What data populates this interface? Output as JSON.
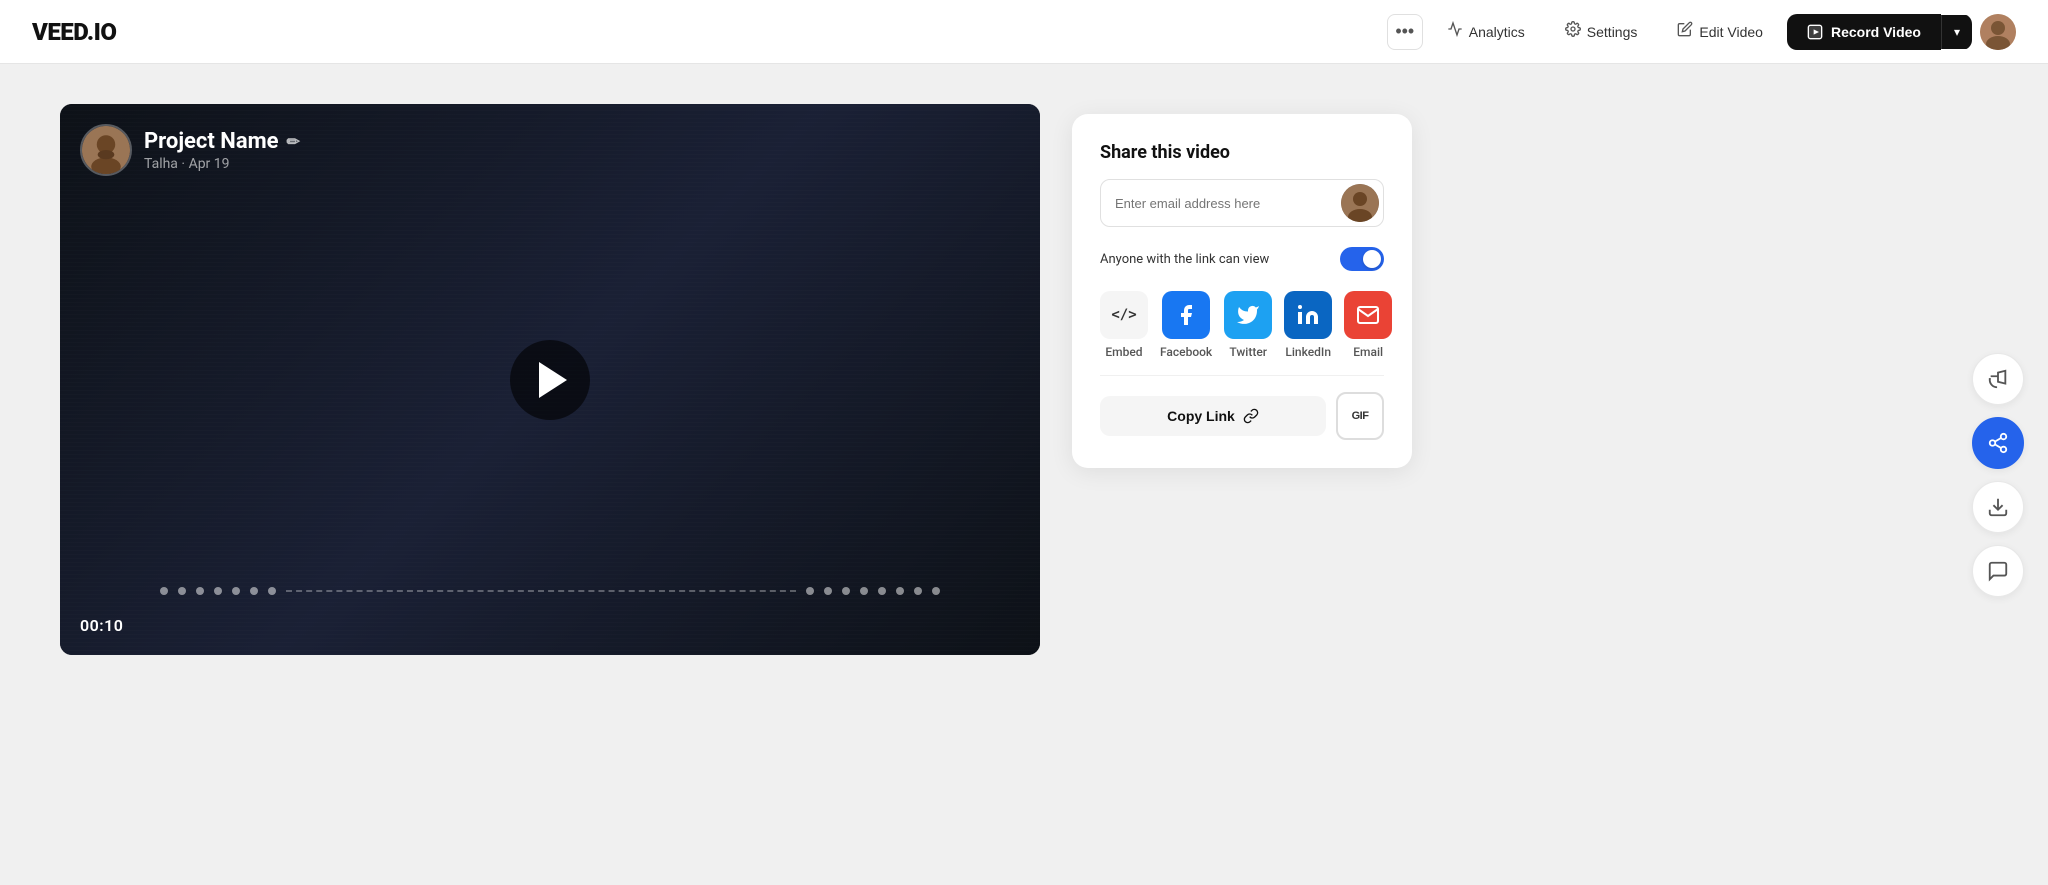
{
  "logo": "VEED.IO",
  "header": {
    "more_label": "•••",
    "analytics_label": "Analytics",
    "settings_label": "Settings",
    "edit_video_label": "Edit Video",
    "record_video_label": "Record Video",
    "record_arrow": "▾"
  },
  "video": {
    "title": "Project Name",
    "edit_icon": "✏",
    "author": "Talha",
    "date": "Apr 19",
    "timestamp": "00:10"
  },
  "share_panel": {
    "title": "Share this video",
    "email_placeholder": "Enter email address here",
    "link_toggle_label": "Anyone with the link can view",
    "social": [
      {
        "id": "embed",
        "label": "Embed",
        "icon": "</>"
      },
      {
        "id": "facebook",
        "label": "Facebook",
        "icon": "f"
      },
      {
        "id": "twitter",
        "label": "Twitter",
        "icon": "t"
      },
      {
        "id": "linkedin",
        "label": "LinkedIn",
        "icon": "in"
      },
      {
        "id": "email",
        "label": "Email",
        "icon": "✉"
      }
    ],
    "copy_link_label": "Copy Link",
    "gif_label": "GIF"
  },
  "right_sidebar": {
    "icons": [
      {
        "id": "megaphone",
        "label": "megaphone-icon",
        "active": false
      },
      {
        "id": "share",
        "label": "share-icon",
        "active": true
      },
      {
        "id": "download",
        "label": "download-icon",
        "active": false
      },
      {
        "id": "comment",
        "label": "comment-icon",
        "active": false
      }
    ]
  }
}
